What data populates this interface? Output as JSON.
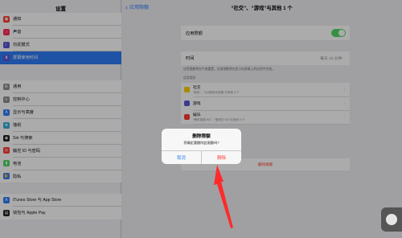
{
  "sidebar": {
    "title": "设置",
    "group1": [
      {
        "label": "通知",
        "color": "#ff3b30",
        "glyph": "▣"
      },
      {
        "label": "声音",
        "color": "#ff2d55",
        "glyph": "♪"
      },
      {
        "label": "勿扰模式",
        "color": "#5856d6",
        "glyph": "☾"
      },
      {
        "label": "屏幕使用时间",
        "color": "#5856d6",
        "glyph": "⧗",
        "selected": true
      }
    ],
    "group2": [
      {
        "label": "通用",
        "color": "#8e8e93",
        "glyph": "⚙"
      },
      {
        "label": "控制中心",
        "color": "#8e8e93",
        "glyph": "≡"
      },
      {
        "label": "显示与亮度",
        "color": "#2f7cf6",
        "glyph": "A"
      },
      {
        "label": "墙纸",
        "color": "#34aadc",
        "glyph": "❀"
      },
      {
        "label": "Siri 与搜索",
        "color": "#222222",
        "glyph": "◉"
      },
      {
        "label": "触控 ID 与密码",
        "color": "#ff3b30",
        "glyph": "◎"
      },
      {
        "label": "电池",
        "color": "#4cd964",
        "glyph": "▮"
      },
      {
        "label": "隐私",
        "color": "#2f7cf6",
        "glyph": "✋"
      }
    ],
    "group3": [
      {
        "label": "iTunes Store 与 App Store",
        "color": "#2f7cf6",
        "glyph": "A"
      },
      {
        "label": "钱包与 Apple Pay",
        "color": "#222222",
        "glyph": "▤"
      }
    ]
  },
  "nav": {
    "back_label": "应用限额",
    "title": "“社交”、“游戏”与其他 1 个"
  },
  "limit": {
    "toggle_label": "应用限额",
    "enabled": true
  },
  "time": {
    "label": "时间",
    "value": "每天 10 分钟"
  },
  "notes": {
    "line1": "应用限额将在午夜重置。应用限额将在显示在屏幕上的应用中生效。",
    "section": "应用类别"
  },
  "categories": [
    {
      "name": "社交",
      "sub": "“微信”、“QQ微信浏览器”与其他 3 个",
      "color": "#ffcc00"
    },
    {
      "name": "游戏",
      "sub": "",
      "color": "#5856d6"
    },
    {
      "name": "娱乐",
      "sub": "“腾讯视频 HD”、“爱奇艺 HD”与其他 5 个",
      "color": "#ff3b30"
    }
  ],
  "delete_link": "删除限额",
  "alert": {
    "title": "删除限额",
    "message": "您确定要删除此限额吗?",
    "cancel": "取消",
    "confirm": "删除"
  },
  "accent": {
    "blue": "#2f7cf6",
    "red": "#ff3b30",
    "green": "#4cd964"
  }
}
